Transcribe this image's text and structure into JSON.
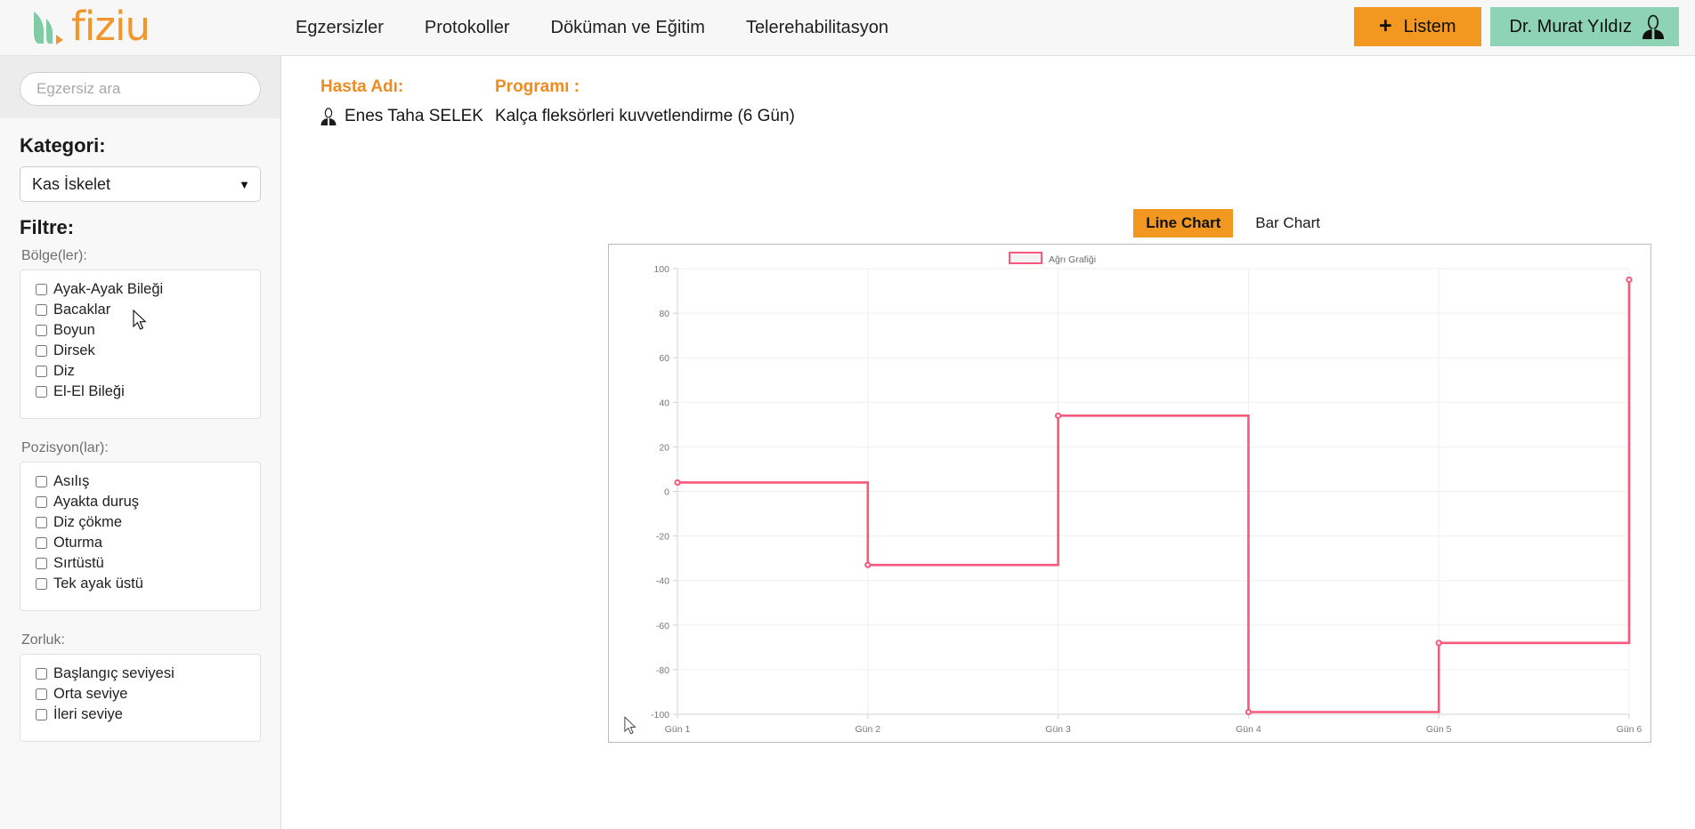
{
  "brand": {
    "name": "fiziu",
    "logo_icon": "leaf-logo-icon",
    "color": "#f2952b",
    "leaf_color": "#7ecba4"
  },
  "nav": {
    "items": [
      {
        "label": "Egzersizler",
        "name": "nav-egzersizler"
      },
      {
        "label": "Protokoller",
        "name": "nav-protokoller"
      },
      {
        "label": "Döküman ve Eğitim",
        "name": "nav-dokuman-egitim"
      },
      {
        "label": "Telerehabilitasyon",
        "name": "nav-telerehabilitasyon"
      }
    ]
  },
  "header_actions": {
    "list_button": {
      "label": "Listem",
      "plus": "+",
      "bg": "#f2971f"
    },
    "user_button": {
      "label": "Dr. Murat Yıldız",
      "icon": "user-avatar-icon",
      "bg": "#8ed3b5"
    }
  },
  "sidebar": {
    "search": {
      "placeholder": "Egzersiz ara",
      "value": ""
    },
    "category": {
      "title": "Kategori:",
      "selected": "Kas İskelet",
      "options": [
        "Kas İskelet"
      ]
    },
    "filter_title": "Filtre:",
    "groups": [
      {
        "label": "Bölge(ler):",
        "name": "filter-group-bolgeler",
        "options": [
          {
            "label": "Ayak-Ayak Bileği",
            "checked": false
          },
          {
            "label": "Bacaklar",
            "checked": false
          },
          {
            "label": "Boyun",
            "checked": false
          },
          {
            "label": "Dirsek",
            "checked": false
          },
          {
            "label": "Diz",
            "checked": false
          },
          {
            "label": "El-El Bileği",
            "checked": false
          }
        ]
      },
      {
        "label": "Pozisyon(lar):",
        "name": "filter-group-pozisyonlar",
        "options": [
          {
            "label": "Asılış",
            "checked": false
          },
          {
            "label": "Ayakta duruş",
            "checked": false
          },
          {
            "label": "Diz çökme",
            "checked": false
          },
          {
            "label": "Oturma",
            "checked": false
          },
          {
            "label": "Sırtüstü",
            "checked": false
          },
          {
            "label": "Tek ayak üstü",
            "checked": false
          }
        ]
      },
      {
        "label": "Zorluk:",
        "name": "filter-group-zorluk",
        "options": [
          {
            "label": "Başlangıç seviyesi",
            "checked": false
          },
          {
            "label": "Orta seviye",
            "checked": false
          },
          {
            "label": "İleri seviye",
            "checked": false
          }
        ]
      }
    ]
  },
  "patient": {
    "name_label": "Hasta Adı:",
    "name_value": "Enes Taha SELEK",
    "program_label": "Programı :",
    "program_value": "Kalça fleksörleri kuvvetlendirme (6 Gün)"
  },
  "chart_tabs": {
    "line": "Line Chart",
    "bar": "Bar Chart",
    "active": "Line Chart",
    "active_bg": "#f2971f"
  },
  "chart_data": {
    "type": "line",
    "line_style": "step",
    "title": "",
    "legend": [
      "Ağrı Grafiği"
    ],
    "legend_position": "top-center",
    "series_color": "#f8587c",
    "categories": [
      "Gün 1",
      "Gün 2",
      "Gün 3",
      "Gün 4",
      "Gün 5",
      "Gün 6"
    ],
    "series": [
      {
        "name": "Ağrı Grafiği",
        "values": [
          4,
          -33,
          34,
          -99,
          -68,
          95
        ]
      }
    ],
    "xlabel": "",
    "ylabel": "",
    "ylim": [
      -100,
      100
    ],
    "yticks": [
      100,
      80,
      60,
      40,
      20,
      0,
      -20,
      -40,
      -60,
      -80,
      -100
    ],
    "grid": true
  }
}
